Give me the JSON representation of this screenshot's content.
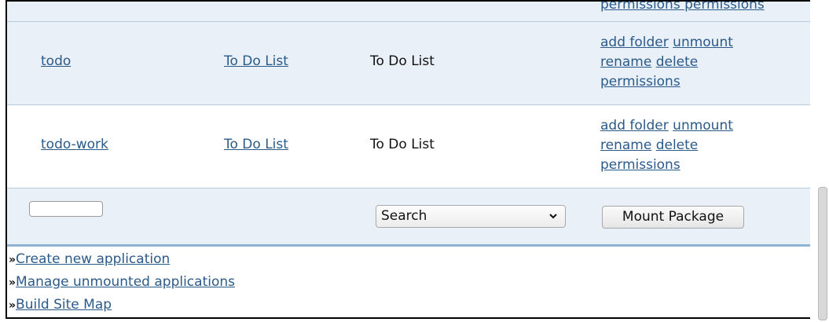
{
  "top_partial": {
    "text": "permissions permissions"
  },
  "rows": [
    {
      "name": "todo",
      "package": "To Do List",
      "title": "To Do List",
      "actions": {
        "add_folder": "add folder",
        "unmount": "unmount",
        "rename": "rename",
        "delete": "delete",
        "permissions": "permissions"
      }
    },
    {
      "name": "todo-work",
      "package": "To Do List",
      "title": "To Do List",
      "actions": {
        "add_folder": "add folder",
        "unmount": "unmount",
        "rename": "rename",
        "delete": "delete",
        "permissions": "permissions"
      }
    }
  ],
  "form": {
    "name_value": "",
    "select_value": "Search",
    "mount_button": "Mount Package"
  },
  "links": {
    "create": "Create new application",
    "manage": "Manage unmounted applications",
    "sitemap": "Build Site Map",
    "bullet": "»"
  }
}
